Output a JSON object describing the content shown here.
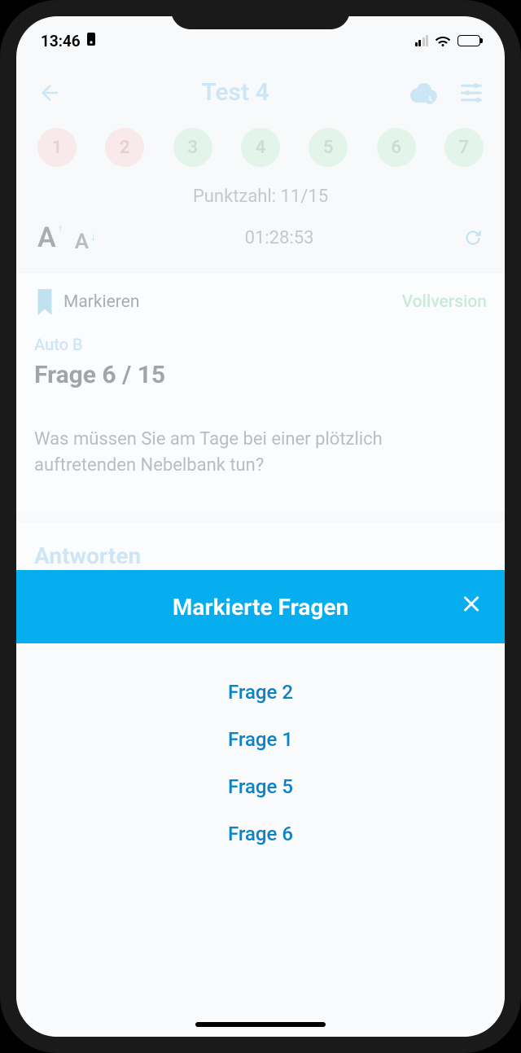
{
  "statusbar": {
    "time": "13:46"
  },
  "header": {
    "title": "Test 4"
  },
  "bubbles": [
    {
      "n": "1",
      "state": "red"
    },
    {
      "n": "2",
      "state": "red"
    },
    {
      "n": "3",
      "state": "green"
    },
    {
      "n": "4",
      "state": "green"
    },
    {
      "n": "5",
      "state": "green"
    },
    {
      "n": "6",
      "state": "green"
    },
    {
      "n": "7",
      "state": "green"
    }
  ],
  "score_label": "Punktzahl: 11/15",
  "timer": "01:28:53",
  "mark_label": "Markieren",
  "vollversion_label": "Vollversion",
  "category": "Auto B",
  "frage_number": "Frage 6 / 15",
  "question_text": "Was müssen Sie am Tage bei einer plötzlich auftretenden Nebelbank tun?",
  "antworten_label": "Antworten",
  "sheet": {
    "title": "Markierte Fragen",
    "items": [
      "Frage 2",
      "Frage 1",
      "Frage 5",
      "Frage 6"
    ]
  }
}
